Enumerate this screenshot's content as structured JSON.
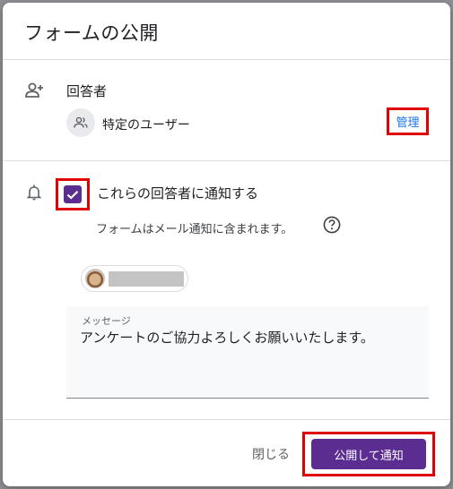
{
  "dialog": {
    "title": "フォームの公開"
  },
  "respondents": {
    "section_label": "回答者",
    "access_text": "特定のユーザー",
    "manage_label": "管理",
    "icons": [
      "add-person-icon",
      "group-icon"
    ]
  },
  "notify": {
    "checkbox_label": "これらの回答者に通知する",
    "checked": true,
    "sub_text": "フォームはメール通知に含まれます。",
    "icons": [
      "bell-icon",
      "help-icon",
      "checkmark-icon"
    ]
  },
  "recipients": {
    "chip_name": ""
  },
  "message": {
    "label": "メッセージ",
    "value": "アンケートのご協力よろしくお願いいたします。"
  },
  "actions": {
    "close_label": "閉じる",
    "publish_label": "公開して通知"
  },
  "colors": {
    "accent": "#5c2d91",
    "link": "#1a73e8",
    "highlight_box": "#e00000"
  }
}
